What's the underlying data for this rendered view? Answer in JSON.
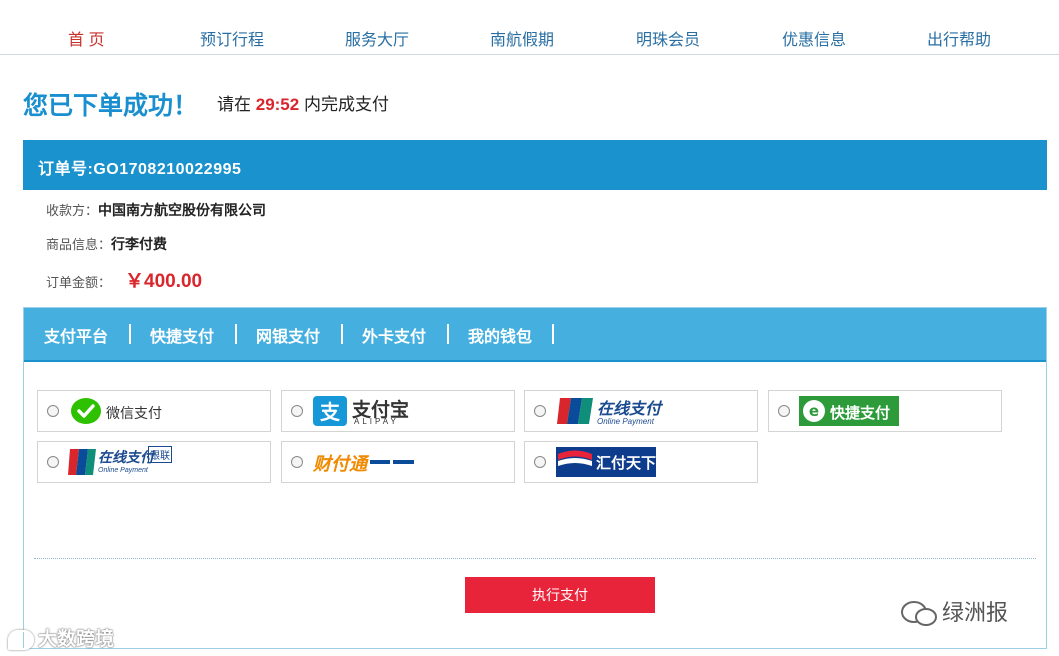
{
  "nav": [
    "首 页",
    "预订行程",
    "服务大厅",
    "南航假期",
    "明珠会员",
    "优惠信息",
    "出行帮助"
  ],
  "header": {
    "title": "您已下单成功！",
    "prefix": "请在",
    "time": "29:52",
    "suffix": "内完成支付"
  },
  "order": {
    "label": "订单号:GO1708210022995"
  },
  "info": {
    "payee_label": "收款方：",
    "payee": "中国南方航空股份有限公司",
    "product_label": "商品信息：",
    "product": "行李付费",
    "amount_label": "订单金额：",
    "amount": "￥400.00"
  },
  "tabs": [
    "支付平台",
    "快捷支付",
    "网银支付",
    "外卡支付",
    "我的钱包"
  ],
  "options": {
    "wechat": "微信支付",
    "alipay": "支付宝",
    "alipay_en": "ALIPAY",
    "unionpay_online": "在线支付",
    "unionpay_online_en": "Online Payment",
    "quick": "快捷支付",
    "unionpay2": "在线支付",
    "unionpay2_en": "Online Payment",
    "unionpay2_badge": "银联",
    "tenpay": "财付通",
    "chinapay": "汇付天下"
  },
  "actions": {
    "pay": "执行支付"
  },
  "watermarks": {
    "left": "大数跨境",
    "right": "绿洲报"
  },
  "colors": {
    "brand": "#1a92cd",
    "price": "#d9262c",
    "button": "#e8243b"
  }
}
